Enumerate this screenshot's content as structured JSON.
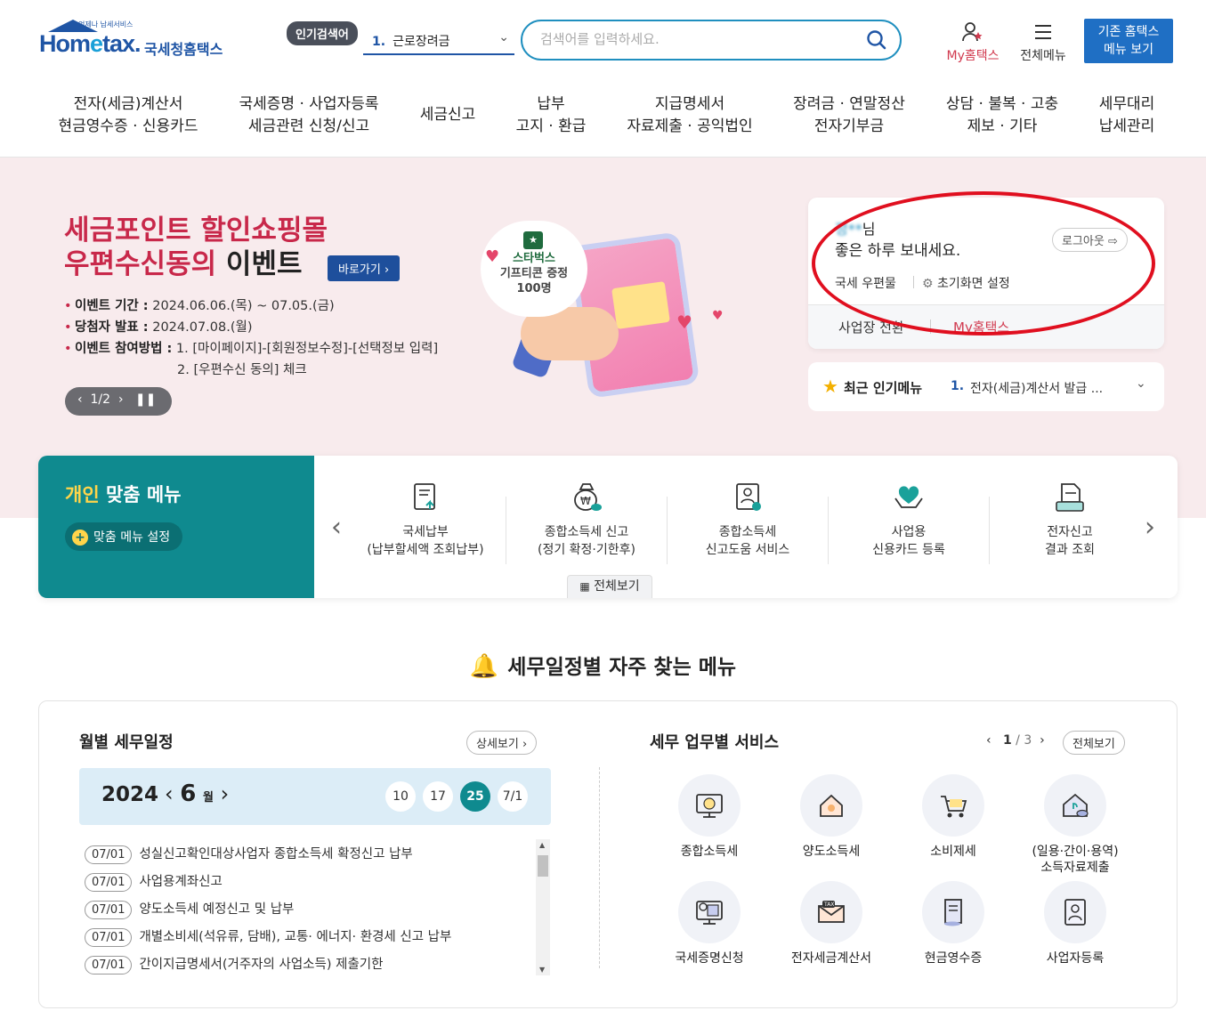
{
  "header": {
    "logo_sub": "언제나 납세서비스",
    "logo_main_a": "Hom",
    "logo_main_e": "e",
    "logo_main_b": "tax.",
    "logo_kor": "국세청홈택스",
    "popular_tag": "인기검색어",
    "popular_num": "1.",
    "popular_value": "근로장려금",
    "search_placeholder": "검색어를 입력하세요.",
    "my_hometax": "My홈택스",
    "all_menu": "전체메뉴",
    "old_menu_line1": "기존 홈택스",
    "old_menu_line2": "메뉴 보기"
  },
  "gnb": [
    {
      "label": "전자(세금)계산서\n현금영수증 · 신용카드"
    },
    {
      "label": "국세증명 · 사업자등록\n세금관련 신청/신고"
    },
    {
      "label": "세금신고"
    },
    {
      "label": "납부\n고지 · 환급"
    },
    {
      "label": "지급명세서\n자료제출 · 공익법인"
    },
    {
      "label": "장려금 · 연말정산\n전자기부금"
    },
    {
      "label": "상담 · 불복 · 고충\n제보 · 기타"
    },
    {
      "label": "세무대리\n납세관리"
    }
  ],
  "hero": {
    "title_line1": "세금포인트 할인쇼핑몰",
    "title_line2_red": "우편수신동의 ",
    "title_line2_dark": "이벤트",
    "go_label": "바로가기",
    "info": [
      {
        "label": "이벤트 기간 :",
        "value": " 2024.06.06.(목) ~ 07.05.(금)"
      },
      {
        "label": "당첨자 발표 :",
        "value": " 2024.07.08.(월)"
      },
      {
        "label": "이벤트 참여방법 :",
        "value": " 1. [마이페이지]-[회원정보수정]-[선택정보 입력]"
      }
    ],
    "info_extra": "2. [우편수신 동의] 체크",
    "pager": "1/2",
    "bubble_line1": "스타벅스",
    "bubble_line2": "기프티콘 증정",
    "bubble_line3": "100명"
  },
  "login": {
    "name_hidden": "정",
    "name_masked": "**",
    "name_suffix": "님",
    "greeting": "좋은 하루 보내세요.",
    "logout": "로그아웃",
    "post": "국세 우편물",
    "init_setting": "초기화면 설정",
    "switch_biz": "사업장 전환",
    "my_hometax": "My홈택스"
  },
  "recent": {
    "label": "최근 인기메뉴",
    "num": "1.",
    "value": "전자(세금)계산서 발급 ..."
  },
  "personal_menu": {
    "title_yellow": "개인",
    "title_rest": " 맞춤 메뉴",
    "setting": "맞춤 메뉴 설정",
    "items": [
      {
        "line1": "국세납부",
        "line2": "(납부할세액 조회납부)"
      },
      {
        "line1": "종합소득세 신고",
        "line2": "(정기 확정·기한후)"
      },
      {
        "line1": "종합소득세",
        "line2": "신고도움 서비스"
      },
      {
        "line1": "사업용",
        "line2": "신용카드 등록"
      },
      {
        "line1": "전자신고",
        "line2": "결과 조회"
      }
    ],
    "view_all": "전체보기"
  },
  "schedule": {
    "section_title": "세무일정별 자주 찾는 메뉴",
    "monthly_title": "월별 세무일정",
    "detail_btn": "상세보기",
    "year": "2024",
    "month": "6",
    "month_unit": "월",
    "days": [
      "10",
      "17",
      "25",
      "7/1"
    ],
    "active_day": "25",
    "events": [
      {
        "date": "07/01",
        "text": "성실신고확인대상사업자 종합소득세 확정신고 납부"
      },
      {
        "date": "07/01",
        "text": "사업용계좌신고"
      },
      {
        "date": "07/01",
        "text": "양도소득세 예정신고 및 납부"
      },
      {
        "date": "07/01",
        "text": "개별소비세(석유류, 담배), 교통· 에너지· 환경세 신고 납부"
      },
      {
        "date": "07/01",
        "text": "간이지급명세서(거주자의 사업소득) 제출기한"
      }
    ]
  },
  "services": {
    "title": "세무 업무별 서비스",
    "page_current": "1",
    "page_total": "/ 3",
    "view_all": "전체보기",
    "items": [
      {
        "line1": "종합소득세",
        "line2": ""
      },
      {
        "line1": "양도소득세",
        "line2": ""
      },
      {
        "line1": "소비제세",
        "line2": ""
      },
      {
        "line1": "(일용·간이·용역)",
        "line2": "소득자료제출"
      },
      {
        "line1": "국세증명신청",
        "line2": ""
      },
      {
        "line1": "전자세금계산서",
        "line2": ""
      },
      {
        "line1": "현금영수증",
        "line2": ""
      },
      {
        "line1": "사업자등록",
        "line2": ""
      }
    ]
  },
  "colors": {
    "brand_blue": "#1f55a5",
    "teal": "#0f8a8f",
    "accent_red": "#c8284a",
    "annotation_red": "#e00f1f"
  }
}
